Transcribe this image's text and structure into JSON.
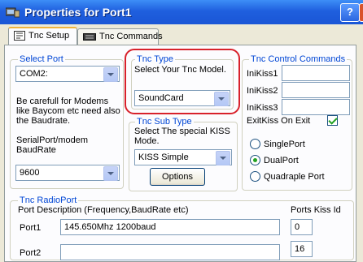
{
  "window": {
    "title": "Properties for Port1",
    "help_label": "?"
  },
  "tabs": [
    {
      "label": "Tnc Setup",
      "active": true
    },
    {
      "label": "Tnc Commands",
      "active": false
    }
  ],
  "select_port": {
    "legend": "Select Port",
    "port_value": "COM2:",
    "warning_text": "Be carefull for Modems like Baycom etc need also the Baudrate.",
    "baud_label": "SerialPort/modem BaudRate",
    "baud_value": "9600"
  },
  "tnc_type": {
    "legend": "Tnc Type",
    "hint": "Select Your Tnc Model.",
    "model_value": "SoundCard"
  },
  "tnc_sub_type": {
    "legend": "Tnc Sub Type",
    "hint": "Select The special KISS Mode.",
    "mode_value": "KISS Simple",
    "options_button": "Options"
  },
  "tnc_control": {
    "legend": "Tnc Control Commands",
    "init_labels": [
      "IniKiss1",
      "IniKiss2",
      "IniKiss3"
    ],
    "init_values": [
      "",
      "",
      ""
    ],
    "exit_label": "ExitKiss On Exit",
    "exit_checked": true,
    "port_modes": [
      {
        "label": "SinglePort",
        "selected": false
      },
      {
        "label": "DualPort",
        "selected": true
      },
      {
        "label": "Quadraple Port",
        "selected": false
      }
    ]
  },
  "radio_port": {
    "legend": "Tnc RadioPort",
    "desc_header": "Port Description (Frequency,BaudRate etc)",
    "kiss_header": "Ports Kiss Id",
    "rows": [
      {
        "label": "Port1",
        "description": "145.650Mhz 1200baud",
        "kiss_id": "0"
      },
      {
        "label": "Port2",
        "description": "",
        "kiss_id": "16"
      }
    ]
  },
  "colors": {
    "titlebar": "#1f5fde",
    "legend": "#0046d5",
    "highlight": "#d8212b"
  }
}
